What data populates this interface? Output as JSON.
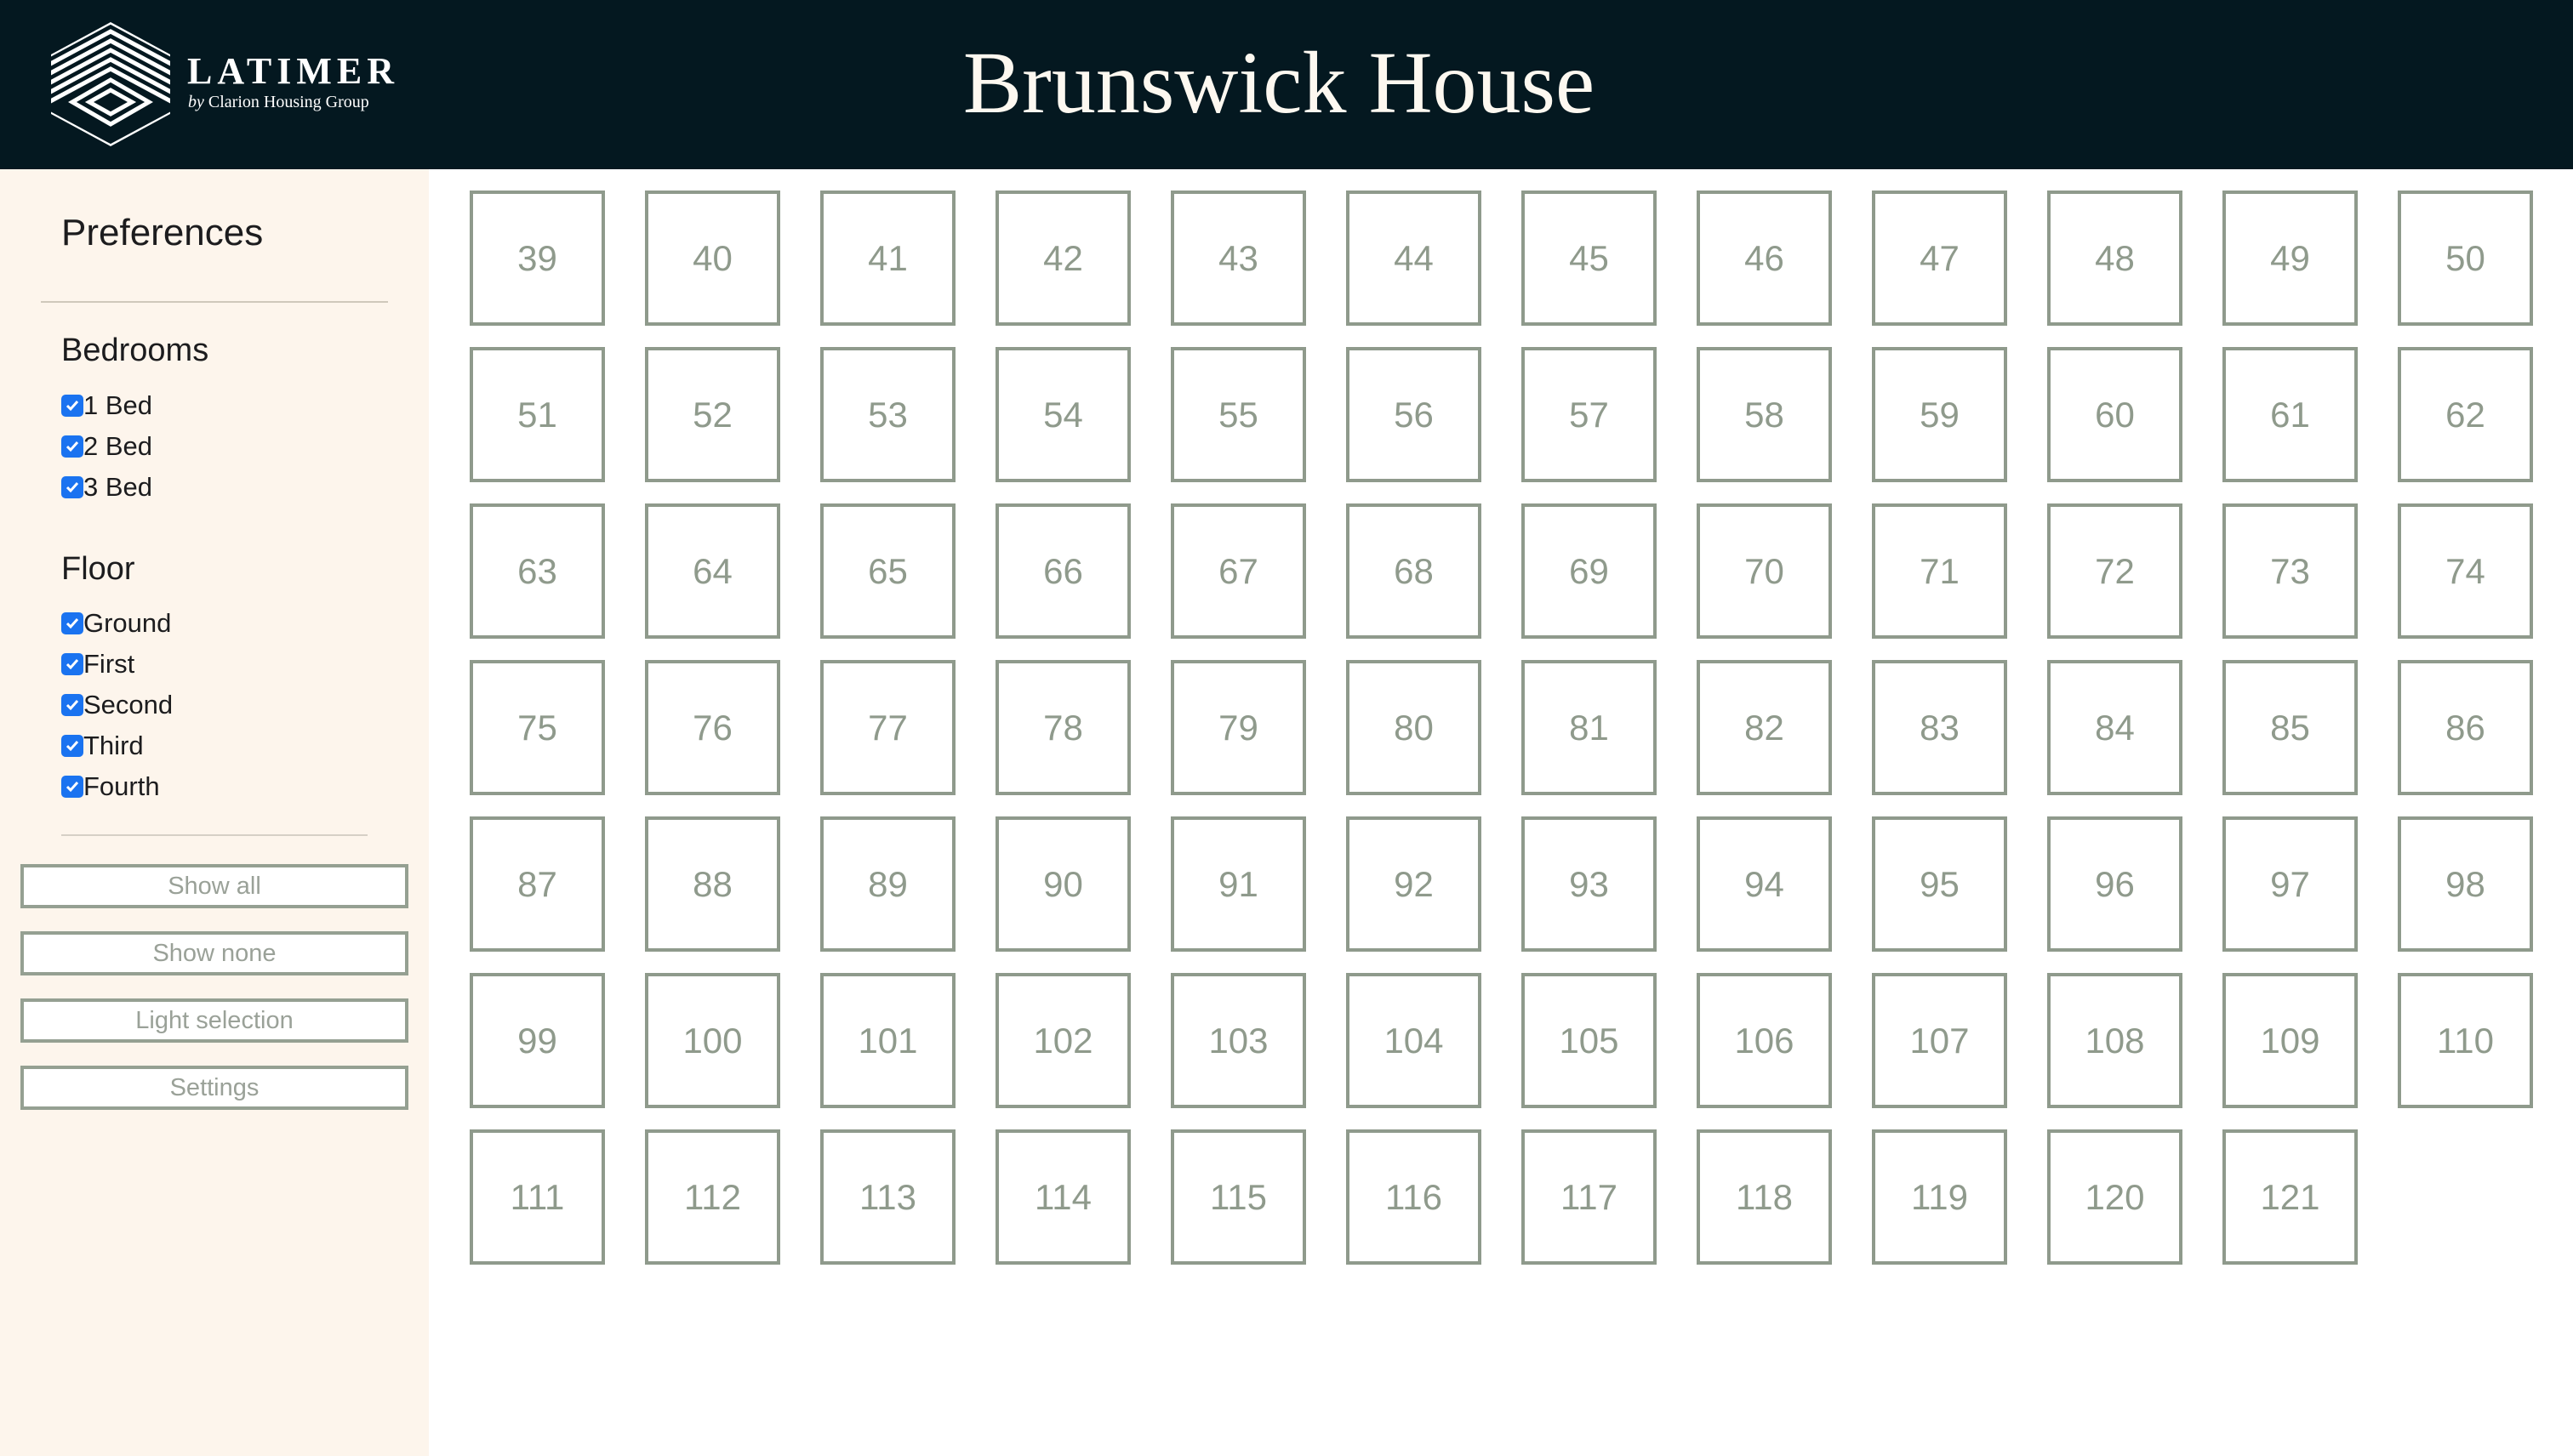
{
  "header": {
    "brand_name": "LATIMER",
    "brand_sub_prefix": "by",
    "brand_sub": "Clarion Housing Group",
    "title": "Brunswick House",
    "logo_icon": "hexagon-stripes-logo-icon"
  },
  "sidebar": {
    "title": "Preferences",
    "bedrooms": {
      "title": "Bedrooms",
      "options": [
        {
          "label": "1 Bed",
          "checked": true
        },
        {
          "label": "2 Bed",
          "checked": true
        },
        {
          "label": "3 Bed",
          "checked": true
        }
      ]
    },
    "floor": {
      "title": "Floor",
      "options": [
        {
          "label": "Ground",
          "checked": true
        },
        {
          "label": "First",
          "checked": true
        },
        {
          "label": "Second",
          "checked": true
        },
        {
          "label": "Third",
          "checked": true
        },
        {
          "label": "Fourth",
          "checked": true
        }
      ]
    },
    "buttons": [
      "Show all",
      "Show none",
      "Light selection",
      "Settings"
    ]
  },
  "units": [
    "39",
    "40",
    "41",
    "42",
    "43",
    "44",
    "45",
    "46",
    "47",
    "48",
    "49",
    "50",
    "51",
    "52",
    "53",
    "54",
    "55",
    "56",
    "57",
    "58",
    "59",
    "60",
    "61",
    "62",
    "63",
    "64",
    "65",
    "66",
    "67",
    "68",
    "69",
    "70",
    "71",
    "72",
    "73",
    "74",
    "75",
    "76",
    "77",
    "78",
    "79",
    "80",
    "81",
    "82",
    "83",
    "84",
    "85",
    "86",
    "87",
    "88",
    "89",
    "90",
    "91",
    "92",
    "93",
    "94",
    "95",
    "96",
    "97",
    "98",
    "99",
    "100",
    "101",
    "102",
    "103",
    "104",
    "105",
    "106",
    "107",
    "108",
    "109",
    "110",
    "111",
    "112",
    "113",
    "114",
    "115",
    "116",
    "117",
    "118",
    "119",
    "120",
    "121"
  ],
  "colors": {
    "header_bg": "#041820",
    "sidebar_bg": "#fdf5ec",
    "tile_border": "#8f9a8c",
    "checkbox": "#1a73f0"
  }
}
